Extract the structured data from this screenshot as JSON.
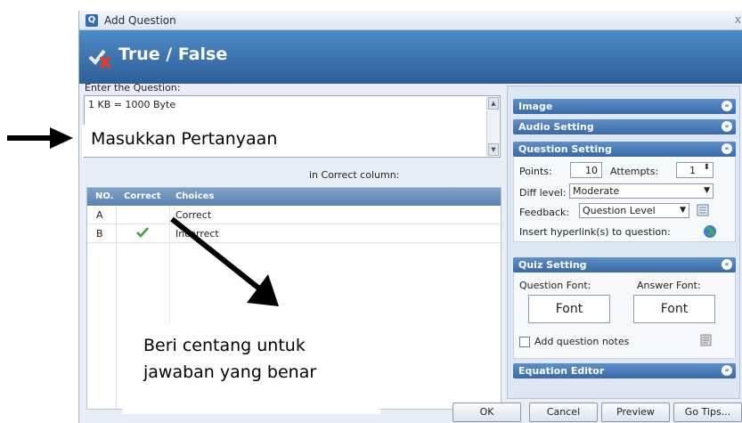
{
  "window": {
    "title": "Add Question",
    "close": "x"
  },
  "banner": {
    "title": "True / False"
  },
  "question": {
    "label": "Enter the Question:",
    "text": "1 KB = 1000 Byte"
  },
  "instruction": "in Correct column:",
  "grid": {
    "headers": {
      "no": "NO.",
      "correct": "Correct",
      "choices": "Choices"
    },
    "rows": [
      {
        "no": "A",
        "correct": false,
        "choice": "Correct"
      },
      {
        "no": "B",
        "correct": true,
        "choice": "Incorrect"
      }
    ]
  },
  "panel": {
    "image": "Image",
    "audio": "Audio Setting",
    "question_setting": {
      "title": "Question Setting",
      "points_label": "Points:",
      "points": "10",
      "attempts_label": "Attempts:",
      "attempts": "1",
      "diff_label": "Diff level:",
      "diff": "Moderate",
      "feedback_label": "Feedback:",
      "feedback": "Question Level",
      "hyperlink": "Insert hyperlink(s) to question:"
    },
    "quiz_setting": {
      "title": "Quiz Setting",
      "qfont_label": "Question Font:",
      "afont_label": "Answer Font:",
      "qfont_btn": "Font",
      "afont_btn": "Font",
      "notes": "Add question notes"
    },
    "equation": "Equation Editor"
  },
  "footer": {
    "ok": "OK",
    "cancel": "Cancel",
    "preview": "Preview",
    "gotips": "Go Tips..."
  },
  "overlays": {
    "question_hint": "Masukkan Pertanyaan",
    "check_hint_1": "Beri centang untuk",
    "check_hint_2": "jawaban yang benar"
  },
  "colors": {
    "banner": "#3b6eab",
    "check": "#3aa63a",
    "section": "#4a7cbb"
  }
}
